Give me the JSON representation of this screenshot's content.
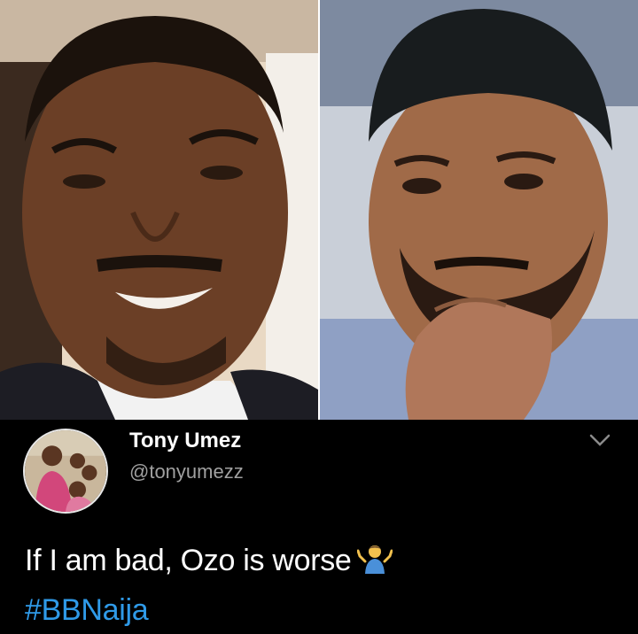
{
  "tweet": {
    "display_name": "Tony Umez",
    "handle": "@tonyumezz",
    "text": "If I am bad, Ozo is worse",
    "emoji": "man-shrugging-emoji",
    "hashtag": "#BBNaija"
  },
  "icons": {
    "menu": "chevron-down-icon"
  },
  "colors": {
    "background": "#000000",
    "text": "#ffffff",
    "handle": "#a0a0a0",
    "hashtag": "#2f9ae8"
  }
}
